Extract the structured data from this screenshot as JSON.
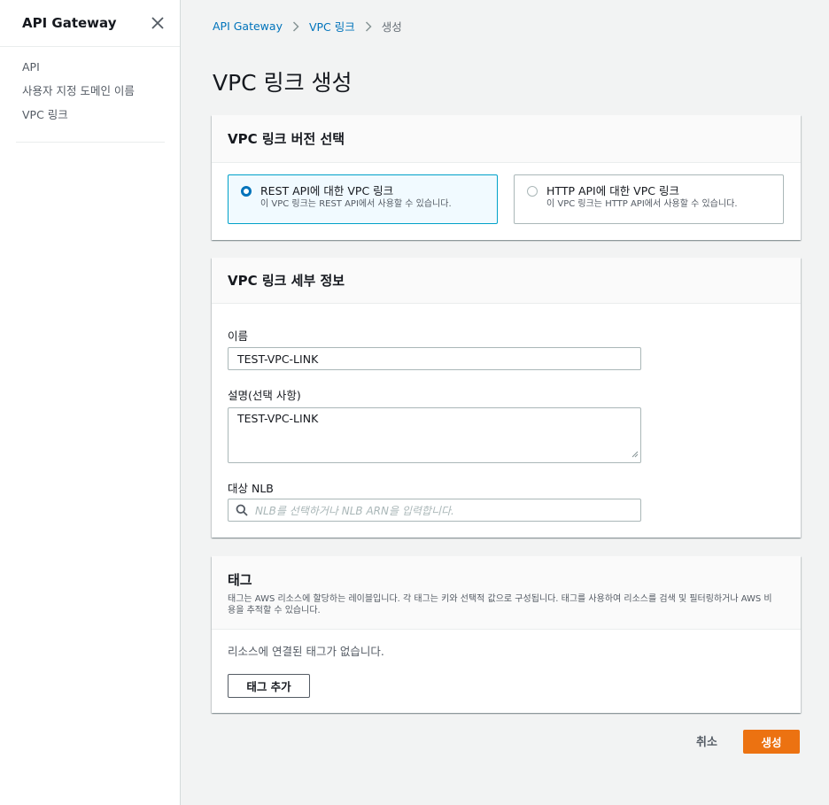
{
  "sidebar": {
    "title": "API Gateway",
    "items": [
      {
        "label": "API"
      },
      {
        "label": "사용자 지정 도메인 이름"
      },
      {
        "label": "VPC 링크"
      }
    ]
  },
  "breadcrumb": {
    "items": [
      "API Gateway",
      "VPC 링크"
    ],
    "current": "생성"
  },
  "page": {
    "title": "VPC 링크 생성"
  },
  "version_panel": {
    "title": "VPC 링크 버전 선택",
    "options": [
      {
        "label": "REST API에 대한 VPC 링크",
        "description": "이 VPC 링크는 REST API에서 사용할 수 있습니다.",
        "selected": true
      },
      {
        "label": "HTTP API에 대한 VPC 링크",
        "description": "이 VPC 링크는 HTTP API에서 사용할 수 있습니다.",
        "selected": false
      }
    ]
  },
  "details_panel": {
    "title": "VPC 링크 세부 정보",
    "name_label": "이름",
    "name_value": "TEST-VPC-LINK",
    "description_label": "설명(선택 사항)",
    "description_value": "TEST-VPC-LINK",
    "nlb_label": "대상 NLB",
    "nlb_placeholder": "NLB를 선택하거나 NLB ARN을 입력합니다."
  },
  "tags_panel": {
    "title": "태그",
    "description": "태그는 AWS 리소스에 할당하는 레이블입니다. 각 태그는 키와 선택적 값으로 구성됩니다. 태그를 사용하여 리소스를 검색 및 필터링하거나 AWS 비용을 추적할 수 있습니다.",
    "empty_text": "리소스에 연결된 태그가 없습니다.",
    "add_button": "태그 추가"
  },
  "actions": {
    "cancel": "취소",
    "create": "생성"
  },
  "colors": {
    "accent": "#ec7211",
    "link": "#0073bb",
    "selected_border": "#00a1c9"
  }
}
